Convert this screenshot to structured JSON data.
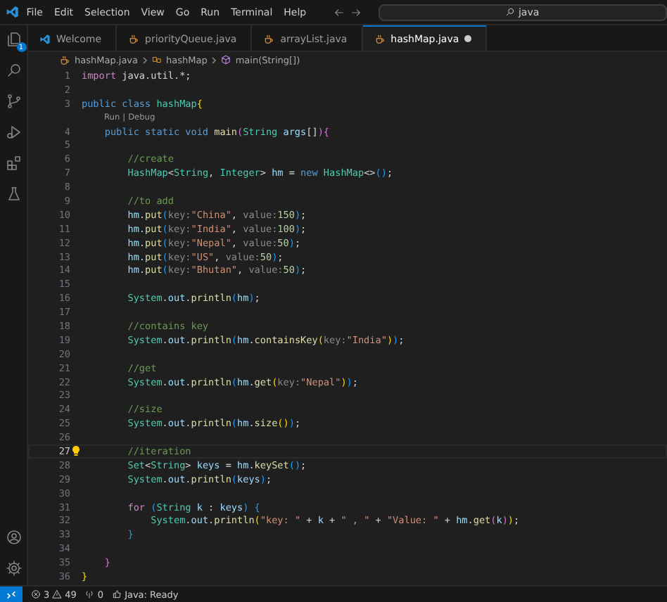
{
  "menu": [
    "File",
    "Edit",
    "Selection",
    "View",
    "Go",
    "Run",
    "Terminal",
    "Help"
  ],
  "search": {
    "value": "java"
  },
  "activity_bar": {
    "explorer_badge": "1"
  },
  "tabs": [
    {
      "label": "Welcome",
      "kind": "welcome",
      "selected": false,
      "modified": false
    },
    {
      "label": "priorityQueue.java",
      "kind": "java",
      "selected": false,
      "modified": false
    },
    {
      "label": "arrayList.java",
      "kind": "java",
      "selected": false,
      "modified": false
    },
    {
      "label": "hashMap.java",
      "kind": "java",
      "selected": true,
      "modified": true
    }
  ],
  "breadcrumb": [
    {
      "label": "hashMap.java",
      "kind": "file"
    },
    {
      "label": "hashMap",
      "kind": "class"
    },
    {
      "label": "main(String[])",
      "kind": "method"
    }
  ],
  "lines": [
    {
      "kind": "code",
      "number": "1",
      "tokens": [
        {
          "kind": "control",
          "text": "import"
        },
        {
          "kind": "plain",
          "text": " java.util.*;"
        }
      ]
    },
    {
      "kind": "code",
      "number": "2"
    },
    {
      "kind": "code",
      "number": "3",
      "tokens": [
        {
          "kind": "keyword",
          "text": "public class "
        },
        {
          "kind": "type",
          "text": "hashMap"
        },
        {
          "kind": "bracket1",
          "text": "{"
        }
      ]
    },
    {
      "kind": "codelens",
      "actions": [
        "Run",
        "Debug"
      ],
      "separator": "|"
    },
    {
      "kind": "code",
      "number": "4",
      "tokens": [
        {
          "kind": "keyword",
          "text": "    public static void "
        },
        {
          "kind": "function",
          "text": "main"
        },
        {
          "kind": "bracket2",
          "text": "("
        },
        {
          "kind": "type",
          "text": "String"
        },
        {
          "kind": "variable",
          "text": " args"
        },
        {
          "kind": "plain",
          "text": "[]"
        },
        {
          "kind": "bracket2",
          "text": "){"
        }
      ]
    },
    {
      "kind": "code",
      "number": "5"
    },
    {
      "kind": "code",
      "number": "6",
      "tokens": [
        {
          "kind": "comment",
          "text": "        //create"
        }
      ]
    },
    {
      "kind": "code",
      "number": "7",
      "tokens": [
        {
          "kind": "type",
          "text": "        HashMap"
        },
        {
          "kind": "plain",
          "text": "<"
        },
        {
          "kind": "type",
          "text": "String"
        },
        {
          "kind": "plain",
          "text": ", "
        },
        {
          "kind": "type",
          "text": "Integer"
        },
        {
          "kind": "plain",
          "text": "> "
        },
        {
          "kind": "variable",
          "text": "hm"
        },
        {
          "kind": "plain",
          "text": " = "
        },
        {
          "kind": "keyword",
          "text": "new "
        },
        {
          "kind": "type",
          "text": "HashMap"
        },
        {
          "kind": "plain",
          "text": "<>"
        },
        {
          "kind": "bracket3",
          "text": "()"
        },
        {
          "kind": "plain",
          "text": ";"
        }
      ]
    },
    {
      "kind": "code",
      "number": "8"
    },
    {
      "kind": "code",
      "number": "9",
      "tokens": [
        {
          "kind": "comment",
          "text": "        //to add"
        }
      ]
    },
    {
      "kind": "code",
      "number": "10",
      "tokens": [
        {
          "kind": "variable",
          "text": "        hm"
        },
        {
          "kind": "plain",
          "text": "."
        },
        {
          "kind": "function",
          "text": "put"
        },
        {
          "kind": "bracket3",
          "text": "("
        },
        {
          "kind": "hint",
          "text": "key:"
        },
        {
          "kind": "string",
          "text": "\"China\""
        },
        {
          "kind": "plain",
          "text": ", "
        },
        {
          "kind": "hint",
          "text": "value:"
        },
        {
          "kind": "number",
          "text": "150"
        },
        {
          "kind": "bracket3",
          "text": ")"
        },
        {
          "kind": "plain",
          "text": ";"
        }
      ]
    },
    {
      "kind": "code",
      "number": "11",
      "tokens": [
        {
          "kind": "variable",
          "text": "        hm"
        },
        {
          "kind": "plain",
          "text": "."
        },
        {
          "kind": "function",
          "text": "put"
        },
        {
          "kind": "bracket3",
          "text": "("
        },
        {
          "kind": "hint",
          "text": "key:"
        },
        {
          "kind": "string",
          "text": "\"India\""
        },
        {
          "kind": "plain",
          "text": ", "
        },
        {
          "kind": "hint",
          "text": "value:"
        },
        {
          "kind": "number",
          "text": "100"
        },
        {
          "kind": "bracket3",
          "text": ")"
        },
        {
          "kind": "plain",
          "text": ";"
        }
      ]
    },
    {
      "kind": "code",
      "number": "12",
      "tokens": [
        {
          "kind": "variable",
          "text": "        hm"
        },
        {
          "kind": "plain",
          "text": "."
        },
        {
          "kind": "function",
          "text": "put"
        },
        {
          "kind": "bracket3",
          "text": "("
        },
        {
          "kind": "hint",
          "text": "key:"
        },
        {
          "kind": "string",
          "text": "\"Nepal\""
        },
        {
          "kind": "plain",
          "text": ", "
        },
        {
          "kind": "hint",
          "text": "value:"
        },
        {
          "kind": "number",
          "text": "50"
        },
        {
          "kind": "bracket3",
          "text": ")"
        },
        {
          "kind": "plain",
          "text": ";"
        }
      ]
    },
    {
      "kind": "code",
      "number": "13",
      "tokens": [
        {
          "kind": "variable",
          "text": "        hm"
        },
        {
          "kind": "plain",
          "text": "."
        },
        {
          "kind": "function",
          "text": "put"
        },
        {
          "kind": "bracket3",
          "text": "("
        },
        {
          "kind": "hint",
          "text": "key:"
        },
        {
          "kind": "string",
          "text": "\"US\""
        },
        {
          "kind": "plain",
          "text": ", "
        },
        {
          "kind": "hint",
          "text": "value:"
        },
        {
          "kind": "number",
          "text": "50"
        },
        {
          "kind": "bracket3",
          "text": ")"
        },
        {
          "kind": "plain",
          "text": ";"
        }
      ]
    },
    {
      "kind": "code",
      "number": "14",
      "tokens": [
        {
          "kind": "variable",
          "text": "        hm"
        },
        {
          "kind": "plain",
          "text": "."
        },
        {
          "kind": "function",
          "text": "put"
        },
        {
          "kind": "bracket3",
          "text": "("
        },
        {
          "kind": "hint",
          "text": "key:"
        },
        {
          "kind": "string",
          "text": "\"Bhutan\""
        },
        {
          "kind": "plain",
          "text": ", "
        },
        {
          "kind": "hint",
          "text": "value:"
        },
        {
          "kind": "number",
          "text": "50"
        },
        {
          "kind": "bracket3",
          "text": ")"
        },
        {
          "kind": "plain",
          "text": ";"
        }
      ]
    },
    {
      "kind": "code",
      "number": "15"
    },
    {
      "kind": "code",
      "number": "16",
      "tokens": [
        {
          "kind": "type",
          "text": "        System"
        },
        {
          "kind": "plain",
          "text": "."
        },
        {
          "kind": "variable",
          "text": "out"
        },
        {
          "kind": "plain",
          "text": "."
        },
        {
          "kind": "function",
          "text": "println"
        },
        {
          "kind": "bracket3",
          "text": "("
        },
        {
          "kind": "variable",
          "text": "hm"
        },
        {
          "kind": "bracket3",
          "text": ")"
        },
        {
          "kind": "plain",
          "text": ";"
        }
      ]
    },
    {
      "kind": "code",
      "number": "17"
    },
    {
      "kind": "code",
      "number": "18",
      "tokens": [
        {
          "kind": "comment",
          "text": "        //contains key"
        }
      ]
    },
    {
      "kind": "code",
      "number": "19",
      "tokens": [
        {
          "kind": "type",
          "text": "        System"
        },
        {
          "kind": "plain",
          "text": "."
        },
        {
          "kind": "variable",
          "text": "out"
        },
        {
          "kind": "plain",
          "text": "."
        },
        {
          "kind": "function",
          "text": "println"
        },
        {
          "kind": "bracket3",
          "text": "("
        },
        {
          "kind": "variable",
          "text": "hm"
        },
        {
          "kind": "plain",
          "text": "."
        },
        {
          "kind": "function",
          "text": "containsKey"
        },
        {
          "kind": "bracket1",
          "text": "("
        },
        {
          "kind": "hint",
          "text": "key:"
        },
        {
          "kind": "string",
          "text": "\"India\""
        },
        {
          "kind": "bracket1",
          "text": ")"
        },
        {
          "kind": "bracket3",
          "text": ")"
        },
        {
          "kind": "plain",
          "text": ";"
        }
      ]
    },
    {
      "kind": "code",
      "number": "20"
    },
    {
      "kind": "code",
      "number": "21",
      "tokens": [
        {
          "kind": "comment",
          "text": "        //get"
        }
      ]
    },
    {
      "kind": "code",
      "number": "22",
      "tokens": [
        {
          "kind": "type",
          "text": "        System"
        },
        {
          "kind": "plain",
          "text": "."
        },
        {
          "kind": "variable",
          "text": "out"
        },
        {
          "kind": "plain",
          "text": "."
        },
        {
          "kind": "function",
          "text": "println"
        },
        {
          "kind": "bracket3",
          "text": "("
        },
        {
          "kind": "variable",
          "text": "hm"
        },
        {
          "kind": "plain",
          "text": "."
        },
        {
          "kind": "function",
          "text": "get"
        },
        {
          "kind": "bracket1",
          "text": "("
        },
        {
          "kind": "hint",
          "text": "key:"
        },
        {
          "kind": "string",
          "text": "\"Nepal\""
        },
        {
          "kind": "bracket1",
          "text": ")"
        },
        {
          "kind": "bracket3",
          "text": ")"
        },
        {
          "kind": "plain",
          "text": ";"
        }
      ]
    },
    {
      "kind": "code",
      "number": "23"
    },
    {
      "kind": "code",
      "number": "24",
      "tokens": [
        {
          "kind": "comment",
          "text": "        //size"
        }
      ]
    },
    {
      "kind": "code",
      "number": "25",
      "tokens": [
        {
          "kind": "type",
          "text": "        System"
        },
        {
          "kind": "plain",
          "text": "."
        },
        {
          "kind": "variable",
          "text": "out"
        },
        {
          "kind": "plain",
          "text": "."
        },
        {
          "kind": "function",
          "text": "println"
        },
        {
          "kind": "bracket3",
          "text": "("
        },
        {
          "kind": "variable",
          "text": "hm"
        },
        {
          "kind": "plain",
          "text": "."
        },
        {
          "kind": "function",
          "text": "size"
        },
        {
          "kind": "bracket1",
          "text": "()"
        },
        {
          "kind": "bracket3",
          "text": ")"
        },
        {
          "kind": "plain",
          "text": ";"
        }
      ]
    },
    {
      "kind": "code",
      "number": "26"
    },
    {
      "kind": "code",
      "number": "27",
      "current": true,
      "tokens": [
        {
          "kind": "comment",
          "text": "        //iteration"
        }
      ]
    },
    {
      "kind": "code",
      "number": "28",
      "tokens": [
        {
          "kind": "type",
          "text": "        Set"
        },
        {
          "kind": "plain",
          "text": "<"
        },
        {
          "kind": "type",
          "text": "String"
        },
        {
          "kind": "plain",
          "text": "> "
        },
        {
          "kind": "variable",
          "text": "keys"
        },
        {
          "kind": "plain",
          "text": " = "
        },
        {
          "kind": "variable",
          "text": "hm"
        },
        {
          "kind": "plain",
          "text": "."
        },
        {
          "kind": "function",
          "text": "keySet"
        },
        {
          "kind": "bracket3",
          "text": "()"
        },
        {
          "kind": "plain",
          "text": ";"
        }
      ]
    },
    {
      "kind": "code",
      "number": "29",
      "tokens": [
        {
          "kind": "type",
          "text": "        System"
        },
        {
          "kind": "plain",
          "text": "."
        },
        {
          "kind": "variable",
          "text": "out"
        },
        {
          "kind": "plain",
          "text": "."
        },
        {
          "kind": "function",
          "text": "println"
        },
        {
          "kind": "bracket3",
          "text": "("
        },
        {
          "kind": "variable",
          "text": "keys"
        },
        {
          "kind": "bracket3",
          "text": ")"
        },
        {
          "kind": "plain",
          "text": ";"
        }
      ]
    },
    {
      "kind": "code",
      "number": "30"
    },
    {
      "kind": "code",
      "number": "31",
      "tokens": [
        {
          "kind": "control",
          "text": "        for "
        },
        {
          "kind": "bracket3",
          "text": "("
        },
        {
          "kind": "type",
          "text": "String"
        },
        {
          "kind": "variable",
          "text": " k"
        },
        {
          "kind": "plain",
          "text": " : "
        },
        {
          "kind": "variable",
          "text": "keys"
        },
        {
          "kind": "bracket3",
          "text": ") {"
        }
      ]
    },
    {
      "kind": "code",
      "number": "32",
      "tokens": [
        {
          "kind": "type",
          "text": "            System"
        },
        {
          "kind": "plain",
          "text": "."
        },
        {
          "kind": "variable",
          "text": "out"
        },
        {
          "kind": "plain",
          "text": "."
        },
        {
          "kind": "function",
          "text": "println"
        },
        {
          "kind": "bracket1",
          "text": "("
        },
        {
          "kind": "string",
          "text": "\"key: \""
        },
        {
          "kind": "plain",
          "text": " + "
        },
        {
          "kind": "variable",
          "text": "k"
        },
        {
          "kind": "plain",
          "text": " + "
        },
        {
          "kind": "string",
          "text": "\" , \""
        },
        {
          "kind": "plain",
          "text": " + "
        },
        {
          "kind": "string",
          "text": "\"Value: \""
        },
        {
          "kind": "plain",
          "text": " + "
        },
        {
          "kind": "variable",
          "text": "hm"
        },
        {
          "kind": "plain",
          "text": "."
        },
        {
          "kind": "function",
          "text": "get"
        },
        {
          "kind": "bracket2",
          "text": "("
        },
        {
          "kind": "variable",
          "text": "k"
        },
        {
          "kind": "bracket2",
          "text": ")"
        },
        {
          "kind": "bracket1",
          "text": ")"
        },
        {
          "kind": "plain",
          "text": ";"
        }
      ]
    },
    {
      "kind": "code",
      "number": "33",
      "tokens": [
        {
          "kind": "bracket3",
          "text": "        }"
        }
      ]
    },
    {
      "kind": "code",
      "number": "34"
    },
    {
      "kind": "code",
      "number": "35",
      "tokens": [
        {
          "kind": "bracket2",
          "text": "    }"
        }
      ]
    },
    {
      "kind": "code",
      "number": "36",
      "tokens": [
        {
          "kind": "bracket1",
          "text": "}"
        }
      ]
    }
  ],
  "status_bar": {
    "errors": "3",
    "warnings": "49",
    "ports": "0",
    "java_status": "Java: Ready"
  }
}
